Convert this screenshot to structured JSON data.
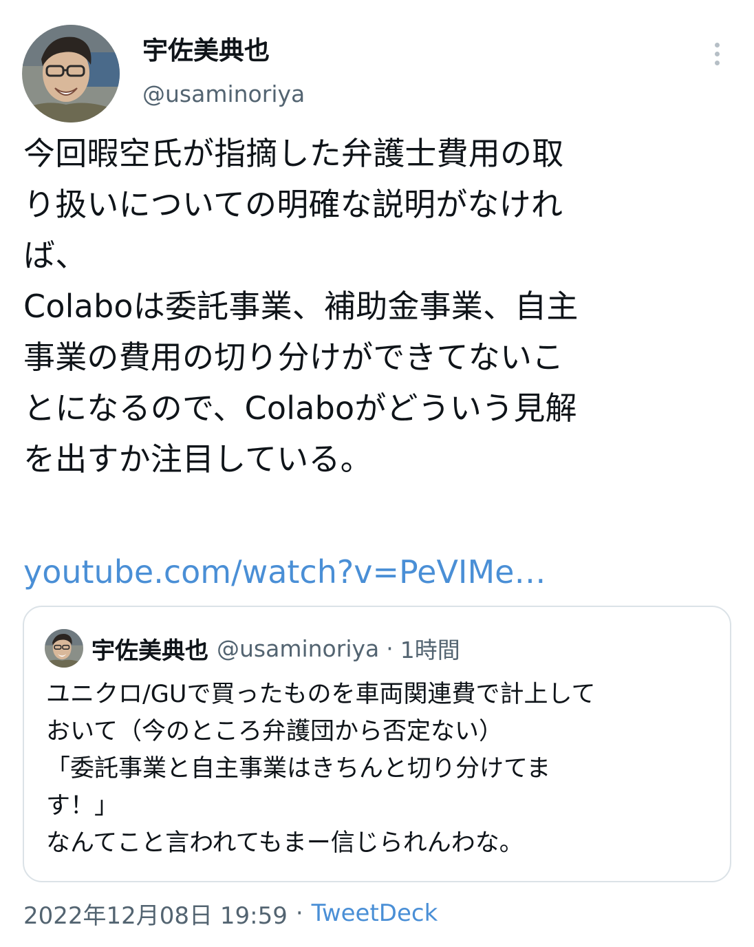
{
  "author": {
    "display_name": "宇佐美典也",
    "handle": "@usaminoriya",
    "avatar_icon": "user-avatar-photo"
  },
  "more_icon": "more-options-vertical-dots-icon",
  "tweet": {
    "text": "今回暇空氏が指摘した弁護士費用の取\nり扱いについての明確な説明がなけれ\nば、\nColaboは委託事業、補助金事業、自主\n事業の費用の切り分けができてないこ\nとになるので、Colaboがどういう見解\nを出すか注目している。",
    "link_text": "youtube.com/watch?v=PeVIMe…"
  },
  "quoted_tweet": {
    "display_name": "宇佐美典也",
    "handle": "@usaminoriya",
    "separator": "·",
    "time": "1時間",
    "text": "ユニクロ/GUで買ったものを車両関連費で計上して\nおいて（今のところ弁護団から否定ない）\n「委託事業と自主事業はきちんと切り分けてま\nす！」\nなんてこと言われてもまー信じられんわな。"
  },
  "meta": {
    "timestamp": "2022年12月08日 19:59",
    "separator": "·",
    "source": "TweetDeck"
  },
  "colors": {
    "link": "#4a8fd6",
    "secondary_text": "#536471",
    "border": "#dbe2e7"
  }
}
